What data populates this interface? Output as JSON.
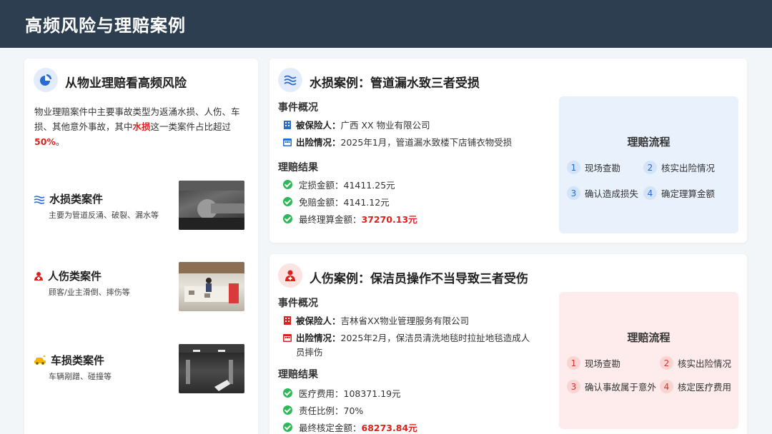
{
  "page": {
    "title": "高频风险与理赔案例"
  },
  "left": {
    "title": "从物业理赔看高频风险",
    "intro_pre": "物业理赔案件中主要事故类型为返涌水损、人伤、车损、其他意外事故，其中",
    "intro_highlight": "水损",
    "intro_mid": "这一类案件占比超过",
    "intro_pct": "50%",
    "intro_end": "。",
    "categories": [
      {
        "title": "水损类案件",
        "desc": "主要为管道反涌、破裂、漏水等",
        "icon": "water-wave-icon"
      },
      {
        "title": "人伤类案件",
        "desc": "顾客/业主滑倒、摔伤等",
        "icon": "person-injury-icon"
      },
      {
        "title": "车损类案件",
        "desc": "车辆剐蹭、碰撞等",
        "icon": "car-crash-icon"
      }
    ]
  },
  "case1": {
    "title": "水损案例：管道漏水致三者受损",
    "overview_h": "事件概况",
    "insured_label": "被保险人：",
    "insured_value": "广西 XX 物业有限公司",
    "incident_label": "出险情况：",
    "incident_value": "2025年1月，管道漏水致楼下店铺衣物受损",
    "result_h": "理赔结果",
    "results": [
      "定损金额：41411.25元",
      "免赔金额：4141.12元"
    ],
    "final_label": "最终理算金额：",
    "final_value": "37270.13元",
    "flow_title": "理赔流程",
    "steps": [
      {
        "n": "1",
        "label": "现场查勘"
      },
      {
        "n": "2",
        "label": "核实出险情况"
      },
      {
        "n": "3",
        "label": "确认造成损失"
      },
      {
        "n": "4",
        "label": "确定理算金额"
      }
    ]
  },
  "case2": {
    "title": "人伤案例：保洁员操作不当导致三者受伤",
    "overview_h": "事件概况",
    "insured_label": "被保险人：",
    "insured_value": "吉林省XX物业管理服务有限公司",
    "incident_label": "出险情况：",
    "incident_value_1": "2025年2月，保洁员清洗地毯时拉扯地毯造成人",
    "incident_value_2": "员摔伤",
    "result_h": "理赔结果",
    "results": [
      "医疗费用：108371.19元",
      "责任比例：70%"
    ],
    "final_label": "最终核定金额：",
    "final_value": "68273.84元",
    "flow_title": "理赔流程",
    "steps": [
      {
        "n": "1",
        "label": "现场查勘"
      },
      {
        "n": "2",
        "label": "核实出险情况"
      },
      {
        "n": "3",
        "label": "确认事故属于意外"
      },
      {
        "n": "4",
        "label": "核定医疗费用"
      }
    ]
  },
  "colors": {
    "header": "#2c3e50",
    "accent_red": "#e0201c",
    "blue_panel": "#e8f1fc",
    "red_panel": "#fdeceb"
  }
}
